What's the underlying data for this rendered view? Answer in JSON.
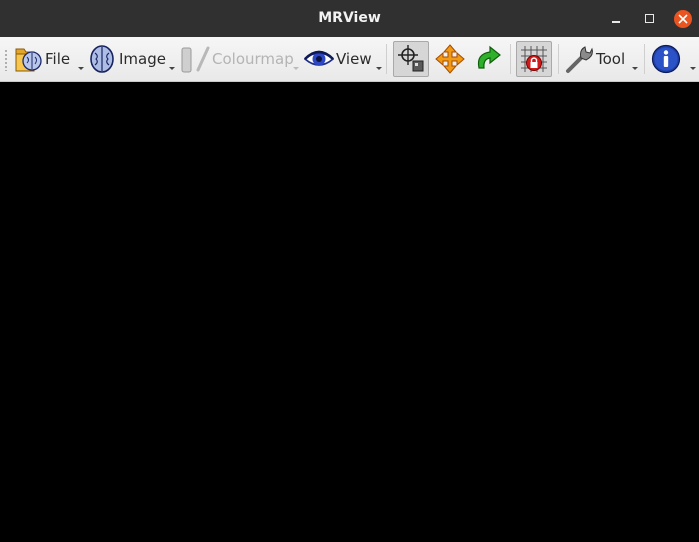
{
  "window": {
    "title": "MRView"
  },
  "toolbar": {
    "file_label": "File",
    "image_label": "Image",
    "colourmap_label": "Colourmap",
    "view_label": "View",
    "tool_label": "Tool"
  },
  "colors": {
    "titlebar": "#303030",
    "close_button": "#e95420",
    "toolbar": "#efefef",
    "viewport": "#000000",
    "disabled_text": "#b4b4b4"
  },
  "icons": {
    "file": "folder-brain-icon",
    "image": "brain-icon",
    "colourmap": "colourmap-icon",
    "view": "eye-icon",
    "mode": "crosshair-select-icon",
    "move": "move-arrows-icon",
    "rotate": "rotate-arrow-icon",
    "lock": "grid-lock-icon",
    "tool": "wrench-icon",
    "info": "info-icon"
  }
}
